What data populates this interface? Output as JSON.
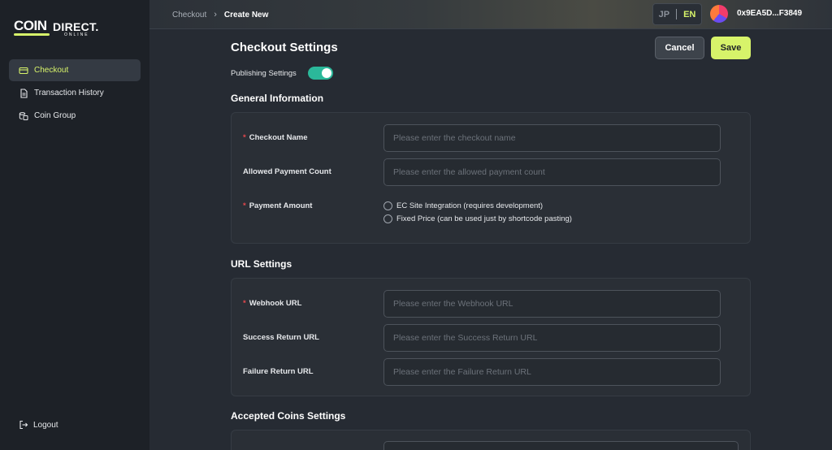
{
  "logo": {
    "part1": "COIN",
    "part2": "DIRECT.",
    "part3": "ONLINE"
  },
  "sidebar": {
    "items": [
      {
        "label": "Checkout",
        "icon": "card-icon",
        "active": true
      },
      {
        "label": "Transaction History",
        "icon": "document-icon",
        "active": false
      },
      {
        "label": "Coin Group",
        "icon": "coins-icon",
        "active": false
      }
    ],
    "logout": "Logout"
  },
  "header": {
    "breadcrumb": [
      "Checkout",
      "Create New"
    ],
    "lang_jp": "JP",
    "lang_en": "EN",
    "wallet": "0x9EA5D...F3849"
  },
  "main": {
    "title": "Checkout Settings",
    "cancel_label": "Cancel",
    "save_label": "Save",
    "publishing_label": "Publishing Settings",
    "publishing_on": true,
    "general": {
      "title": "General Information",
      "checkout_name_label": "Checkout Name",
      "checkout_name_placeholder": "Please enter the checkout name",
      "payment_count_label": "Allowed Payment Count",
      "payment_count_placeholder": "Please enter the allowed payment count",
      "payment_amount_label": "Payment Amount",
      "option_ec": "EC Site Integration (requires development)",
      "option_fixed": "Fixed Price (can be used just by shortcode pasting)"
    },
    "url": {
      "title": "URL Settings",
      "webhook_label": "Webhook URL",
      "webhook_placeholder": "Please enter the Webhook URL",
      "success_label": "Success Return URL",
      "success_placeholder": "Please enter the Success Return URL",
      "failure_label": "Failure Return URL",
      "failure_placeholder": "Please enter the Failure Return URL"
    },
    "coins": {
      "title": "Accepted Coins Settings"
    }
  },
  "colors": {
    "accent": "#d7f36a",
    "toggle": "#2bb89a",
    "required": "#e5484d"
  }
}
